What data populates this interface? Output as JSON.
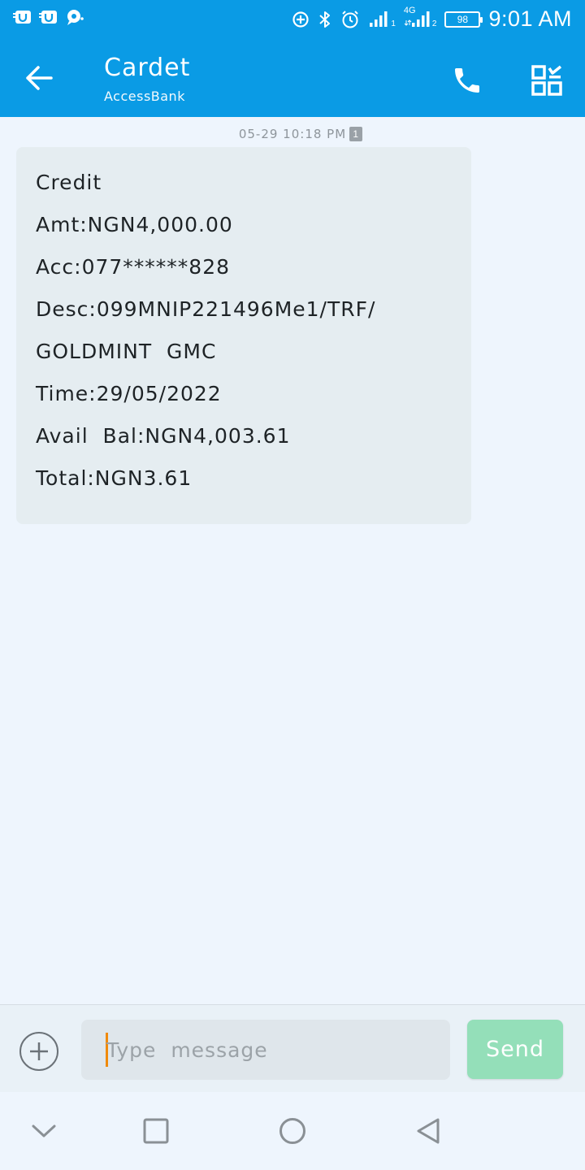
{
  "status_bar": {
    "left_icons": [
      "notification-u-icon",
      "notification-u-icon",
      "chat-bubble-icon"
    ],
    "right_icons": [
      "data-saver-icon",
      "bluetooth-icon",
      "alarm-icon",
      "signal-sim1-icon",
      "signal-4g-sim2-icon"
    ],
    "sim1_label": "1",
    "network_label": "4G",
    "sim2_label": "2",
    "battery": "98",
    "time": "9:01 AM"
  },
  "app_bar": {
    "title": "Cardet",
    "subtitle": "AccessBank",
    "color": "#0a9be5"
  },
  "conversation": {
    "timestamp": "05-29  10:18  PM",
    "sim_badge": "1",
    "message_lines": [
      "Credit",
      "Amt:NGN4,000.00",
      "Acc:077******828",
      "Desc:099MNIP221496Me1/TRF/",
      "GOLDMINT  GMC",
      "Time:29/05/2022",
      "Avail  Bal:NGN4,003.61",
      "Total:NGN3.61"
    ]
  },
  "composer": {
    "placeholder": "Type  message",
    "send_label": "Send",
    "send_color": "#94dfb9"
  },
  "nav_bar": {
    "icons": [
      "chevron-down-icon",
      "recents-icon",
      "home-icon",
      "back-triangle-icon"
    ]
  }
}
